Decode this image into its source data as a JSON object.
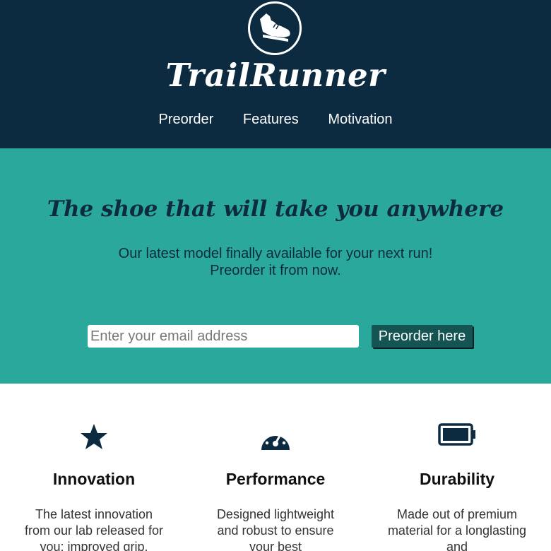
{
  "header": {
    "logo_icon": "running-shoe-icon",
    "brand": "TrailRunner",
    "nav": [
      "Preorder",
      "Features",
      "Motivation"
    ]
  },
  "hero": {
    "title": "The shoe that will take you anywhere",
    "subtitle_line1": "Our latest model finally available for your next run!",
    "subtitle_line2": "Preorder it from now.",
    "email_placeholder": "Enter your email address",
    "button_label": "Preorder here"
  },
  "features": [
    {
      "icon": "star-icon",
      "title": "Innovation",
      "text": "The latest innovation from our lab released for you: improved grip."
    },
    {
      "icon": "speedometer-icon",
      "title": "Performance",
      "text": "Designed lightweight and robust to ensure your best"
    },
    {
      "icon": "battery-icon",
      "title": "Durability",
      "text": "Made out of premium material for a longlasting and"
    }
  ],
  "colors": {
    "header_bg": "#0c2b40",
    "hero_bg": "#2aa89b",
    "button_bg": "#145553",
    "icon_color": "#0c2b40"
  }
}
